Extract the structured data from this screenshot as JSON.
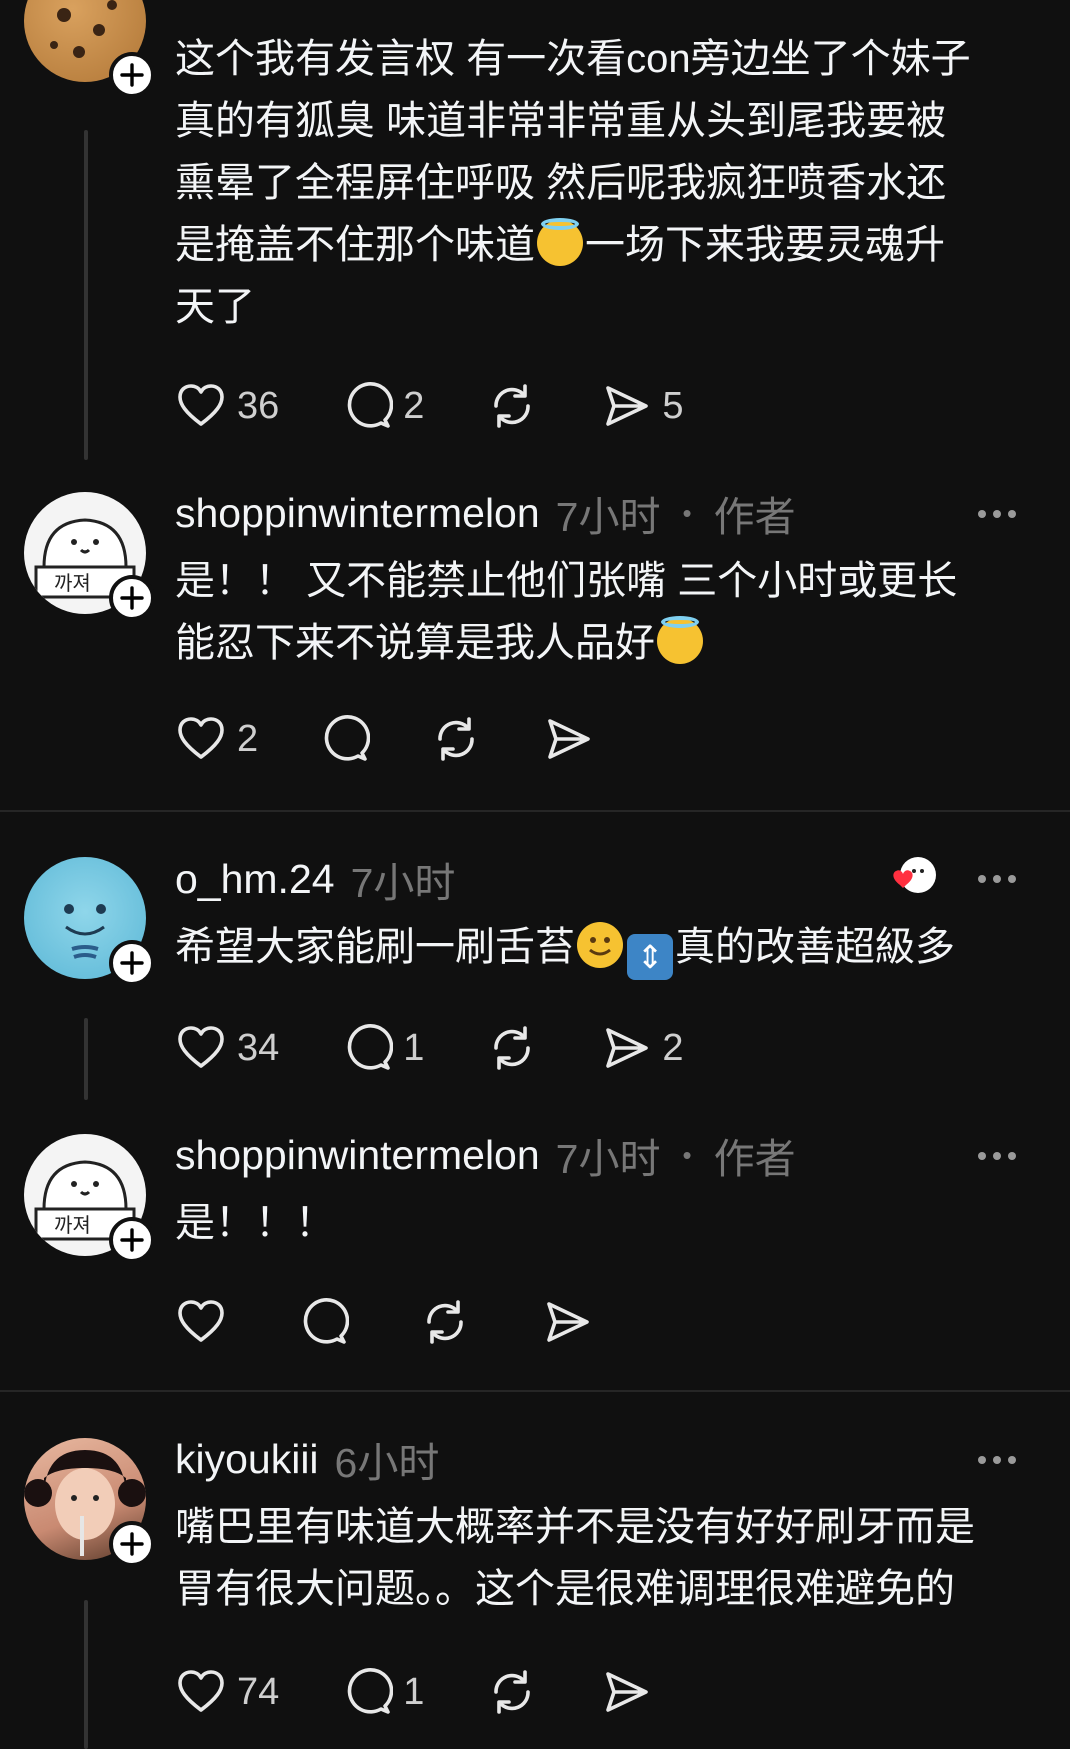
{
  "posts": [
    {
      "text_line1": "这个我有发言权 有一次看con旁边坐了个妹子",
      "text_line2": "真的有狐臭 味道非常非常重从头到尾我要被",
      "text_line3": "熏晕了全程屏住呼吸 然后呢我疯狂喷香水还",
      "text_line4a": "是掩盖不住那个味道",
      "text_line4b": "一场下来我要灵魂升",
      "text_line5": "天了",
      "likes": "36",
      "replies": "2",
      "shares": "5",
      "avatar_icon": "cookie-avatar"
    },
    {
      "username": "shoppinwintermelon",
      "time": "7小时",
      "author_label": "作者",
      "text_line1": "是！！ 又不能禁止他们张嘴 三个小时或更长",
      "text_line2": "能忍下来不说算是我人品好",
      "likes": "2",
      "avatar_icon": "white-dog-avatar"
    },
    {
      "username": "o_hm.24",
      "time": "7小时",
      "text_a": "希望大家能刷一刷舌苔",
      "text_b": "真的改善超級多",
      "likes": "34",
      "replies": "1",
      "shares": "2",
      "avatar_icon": "wooper-avatar"
    },
    {
      "username": "shoppinwintermelon",
      "time": "7小时",
      "author_label": "作者",
      "text_line1": "是！！！",
      "avatar_icon": "white-dog-avatar"
    },
    {
      "username": "kiyoukiii",
      "time": "6小时",
      "text_line1": "嘴巴里有味道大概率并不是没有好好刷牙而是",
      "text_line2": "胃有很大问题。。这个是很难调理很难避免的",
      "likes": "74",
      "replies": "1",
      "avatar_icon": "girl-photo-avatar"
    }
  ],
  "colors": {
    "background": "#101010",
    "text": "#f3f5f7",
    "muted": "#777777",
    "heart": "#ff3040"
  }
}
